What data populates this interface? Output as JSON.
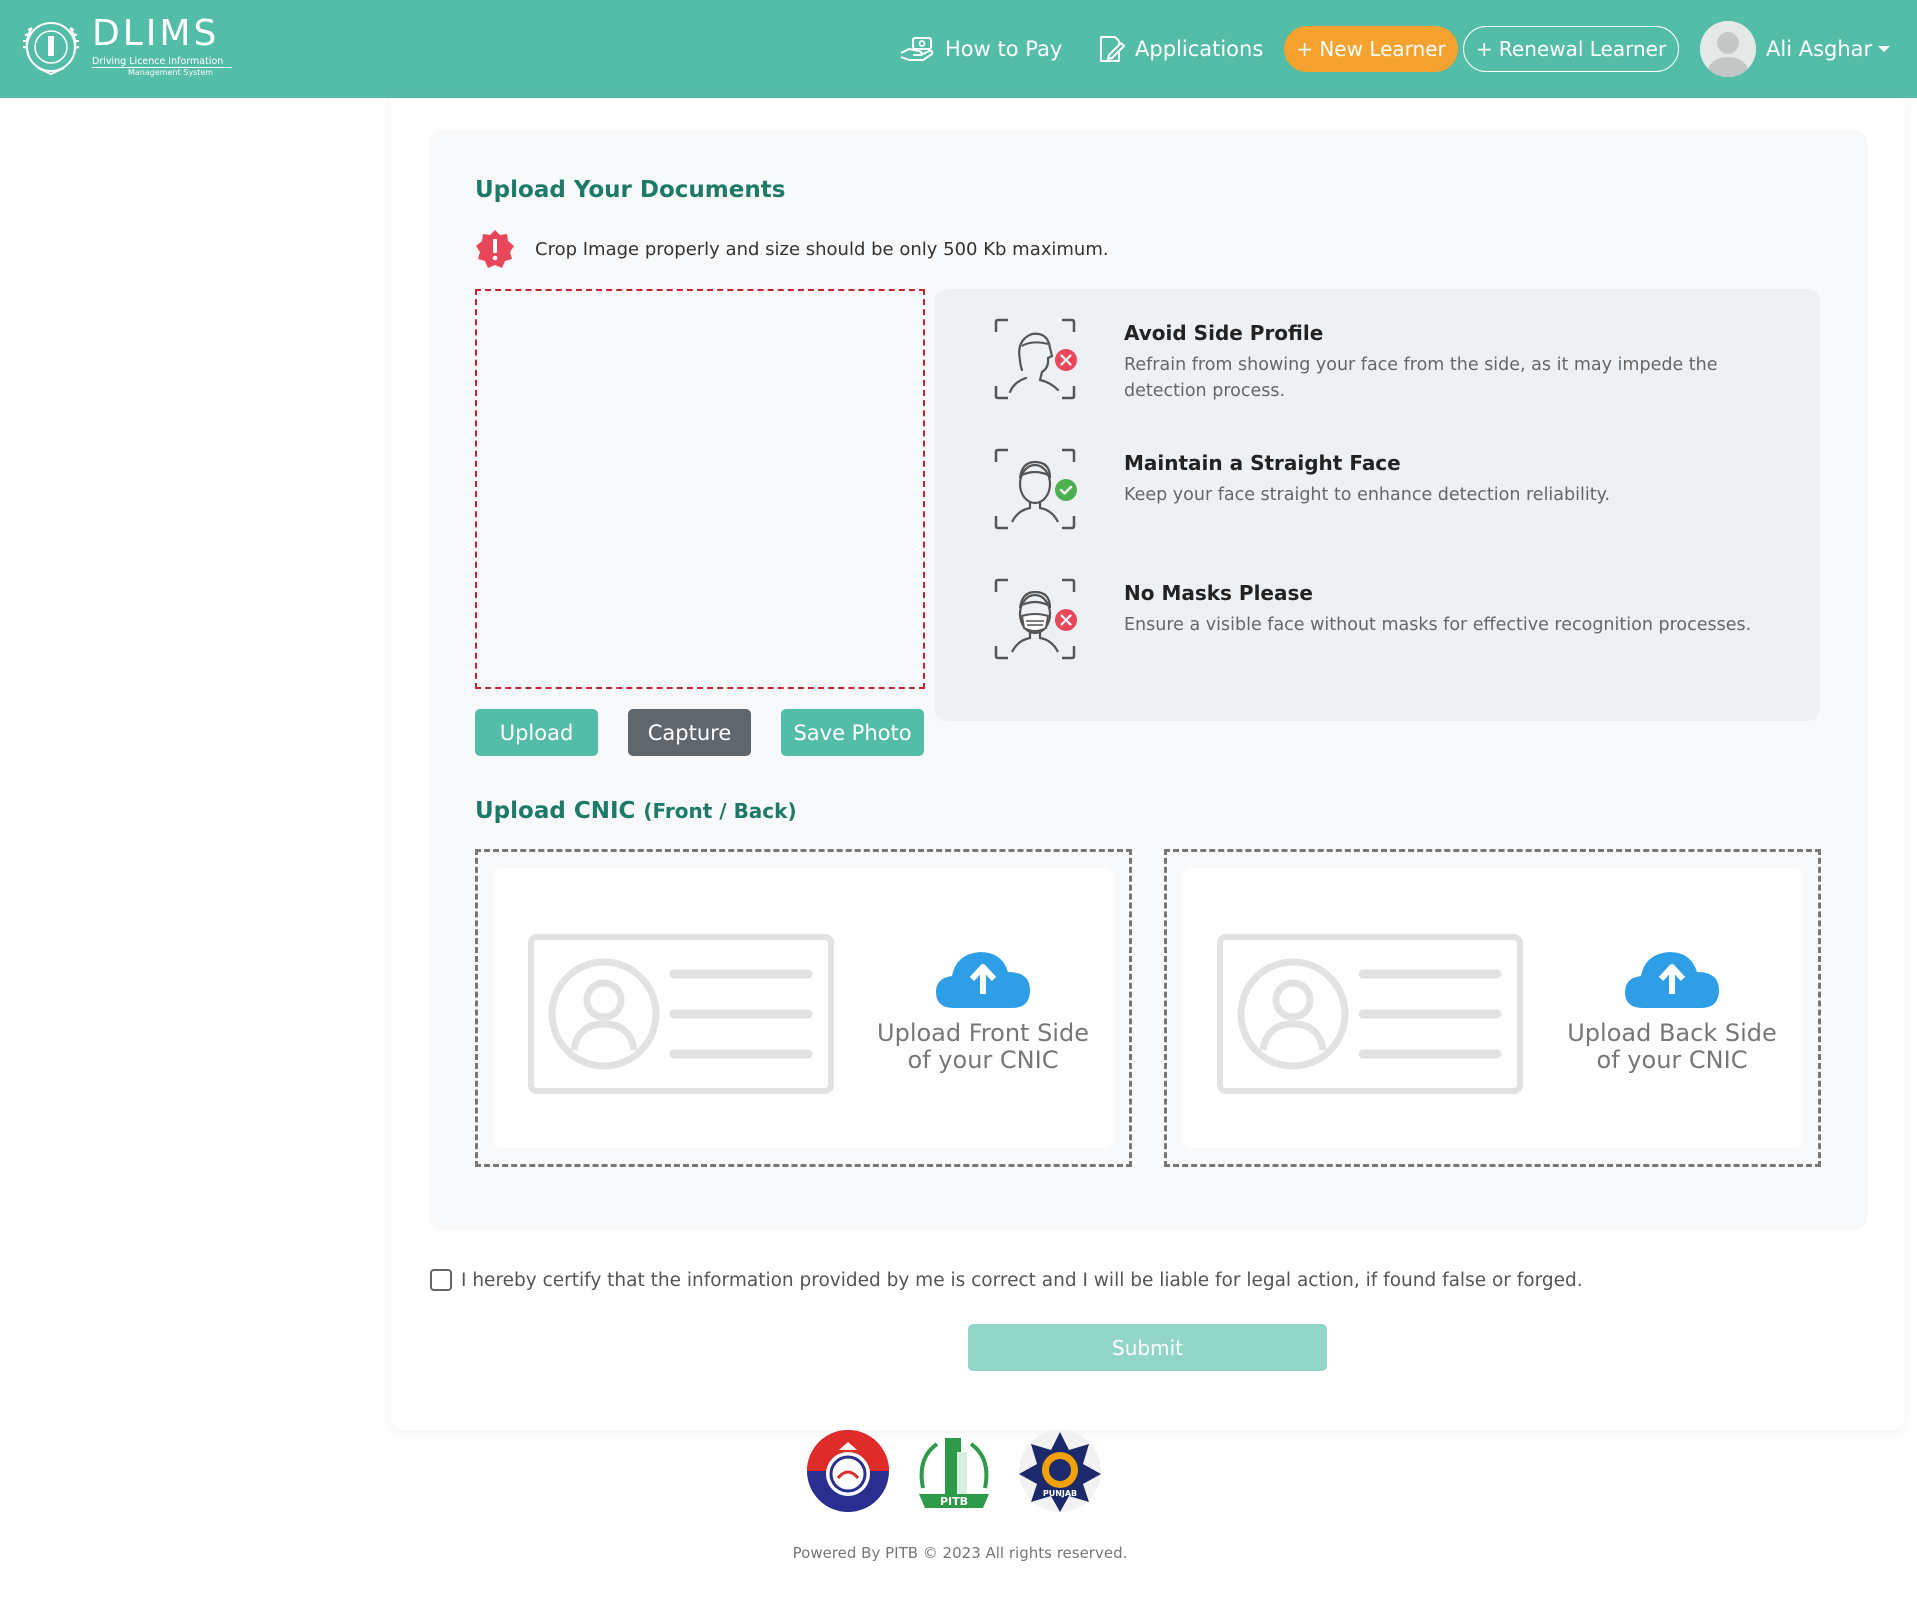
{
  "nav": {
    "logo_title": "DLIMS",
    "logo_sub1": "Driving Licence Information",
    "logo_sub2": "Management System",
    "how_to_pay": "How to Pay",
    "applications": "Applications",
    "new_learner": "+ New Learner",
    "renewal_learner": "+ Renewal Learner",
    "user_name": "Ali Asghar"
  },
  "documents": {
    "title": "Upload Your Documents",
    "notice": "Crop Image properly and size should be only 500 Kb maximum.",
    "upload_label": "Upload",
    "capture_label": "Capture",
    "save_label": "Save Photo"
  },
  "guidelines": [
    {
      "title": "Avoid Side Profile",
      "desc": "Refrain from showing your face from the side, as it may impede the detection process.",
      "status": "error",
      "icon": "side-profile-icon"
    },
    {
      "title": "Maintain a Straight Face",
      "desc": "Keep your face straight to enhance detection reliability.",
      "status": "ok",
      "icon": "straight-face-icon"
    },
    {
      "title": "No Masks Please",
      "desc": "Ensure a visible face without masks for effective recognition processes.",
      "status": "error",
      "icon": "mask-face-icon"
    }
  ],
  "cnic": {
    "title": "Upload CNIC",
    "title_sub": "(Front / Back)",
    "front_line1": "Upload Front Side",
    "front_line2": "of your CNIC",
    "back_line1": "Upload Back Side",
    "back_line2": "of your CNIC"
  },
  "form": {
    "certify_text": "I hereby certify that the information provided by me is correct and I will be liable for legal action, if found false or forged.",
    "certify_checked": false,
    "submit_label": "Submit"
  },
  "footer": {
    "logos": [
      "punjab-police-logo",
      "pitb-logo",
      "traffic-police-punjab-logo"
    ],
    "pitb_logo_text": "PITB",
    "traffic_logo_text": "PUNJAB",
    "copyright": "Powered By PITB © 2023 All rights reserved."
  },
  "colors": {
    "brand": "#54bda8",
    "accent": "#f5a22e",
    "heading": "#1e7a68",
    "error": "#e8475a",
    "success": "#4caf50"
  }
}
